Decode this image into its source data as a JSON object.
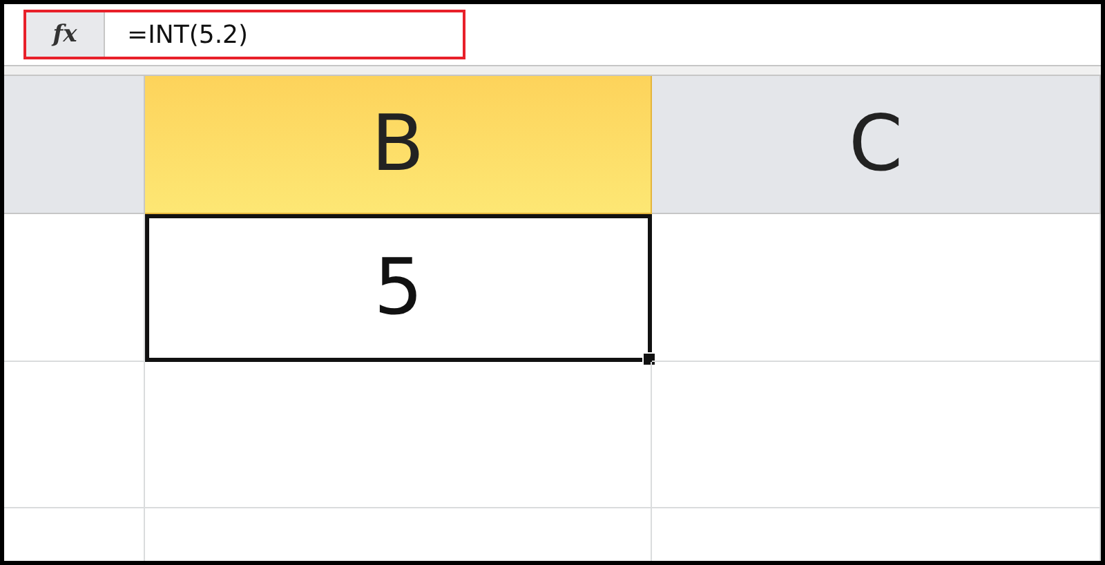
{
  "formula_bar": {
    "function_label": "fx",
    "formula": "=INT(5.2)",
    "highlighted": true
  },
  "columns": [
    {
      "label": "B",
      "selected": true
    },
    {
      "label": "C",
      "selected": false
    }
  ],
  "rows": [
    {
      "cells": [
        {
          "value": "5",
          "selected": true
        },
        {
          "selected": false
        }
      ]
    },
    {
      "cells": [
        {
          "selected": false
        },
        {
          "selected": false
        }
      ]
    },
    {
      "cells": [
        {
          "selected": false
        },
        {
          "selected": false
        }
      ]
    }
  ]
}
